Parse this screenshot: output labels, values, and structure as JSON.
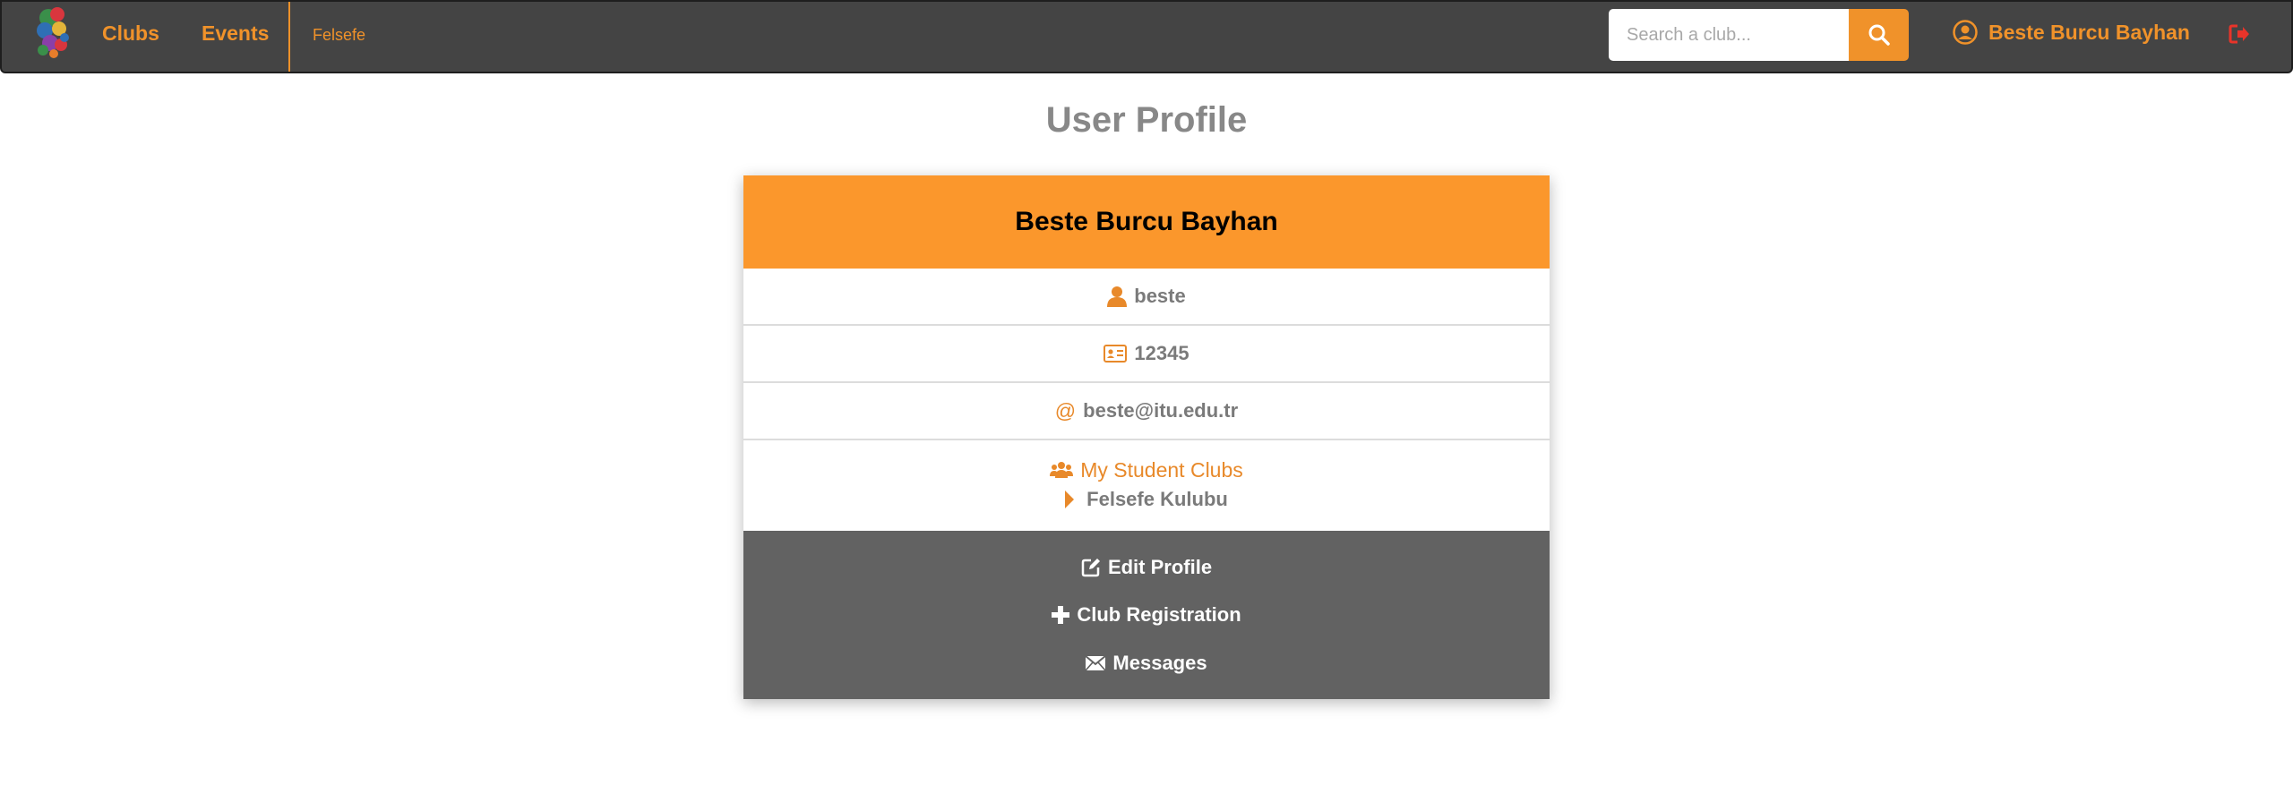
{
  "navbar": {
    "logo_alt": "club logo",
    "links": {
      "clubs": "Clubs",
      "events": "Events"
    },
    "current_club": "Felsefe",
    "search": {
      "placeholder": "Search a club...",
      "value": ""
    },
    "user_name": "Beste Burcu Bayhan"
  },
  "page": {
    "title": "User Profile"
  },
  "profile": {
    "full_name": "Beste Burcu Bayhan",
    "username": "beste",
    "student_id": "12345",
    "email_prefix": "@",
    "email": "beste@itu.edu.tr",
    "clubs_heading": "My Student Clubs",
    "clubs": [
      "Felsefe Kulubu"
    ]
  },
  "actions": {
    "edit": "Edit Profile",
    "register": "Club Registration",
    "messages": "Messages"
  },
  "colors": {
    "accent": "#f0922a",
    "header": "#fb972c",
    "navbar": "#444444",
    "actions_bg": "#626262",
    "logout": "#e8342a"
  },
  "icons": [
    "logo",
    "search-icon",
    "user-circle-icon",
    "logout-icon",
    "user-icon",
    "id-card-icon",
    "users-icon",
    "caret-right-icon",
    "edit-icon",
    "plus-icon",
    "envelope-icon"
  ]
}
